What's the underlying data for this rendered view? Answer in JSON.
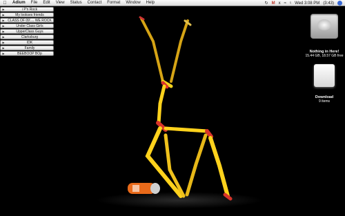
{
  "menubar": {
    "app": "Adium",
    "items": [
      "File",
      "Edit",
      "View",
      "Status",
      "Contact",
      "Format",
      "Window",
      "Help"
    ],
    "clock": "Wed 3:08 PM",
    "battery": "(3:43)",
    "gmail": "M"
  },
  "buddy_groups": [
    "i P'n Rock",
    "My lookses friends",
    "CLASS OF 09'.... WE ROCK",
    "Under Class Girls",
    "UpperClass Guys",
    "Clarksburg",
    "IDK",
    "Family",
    "BEEBOOP BOp"
  ],
  "desktop": {
    "hard_drive": {
      "title": "Nothing in Here!",
      "info": "15.44 GB, 18.57 GB free"
    },
    "download": {
      "title": "Download",
      "info": "9 items"
    }
  }
}
